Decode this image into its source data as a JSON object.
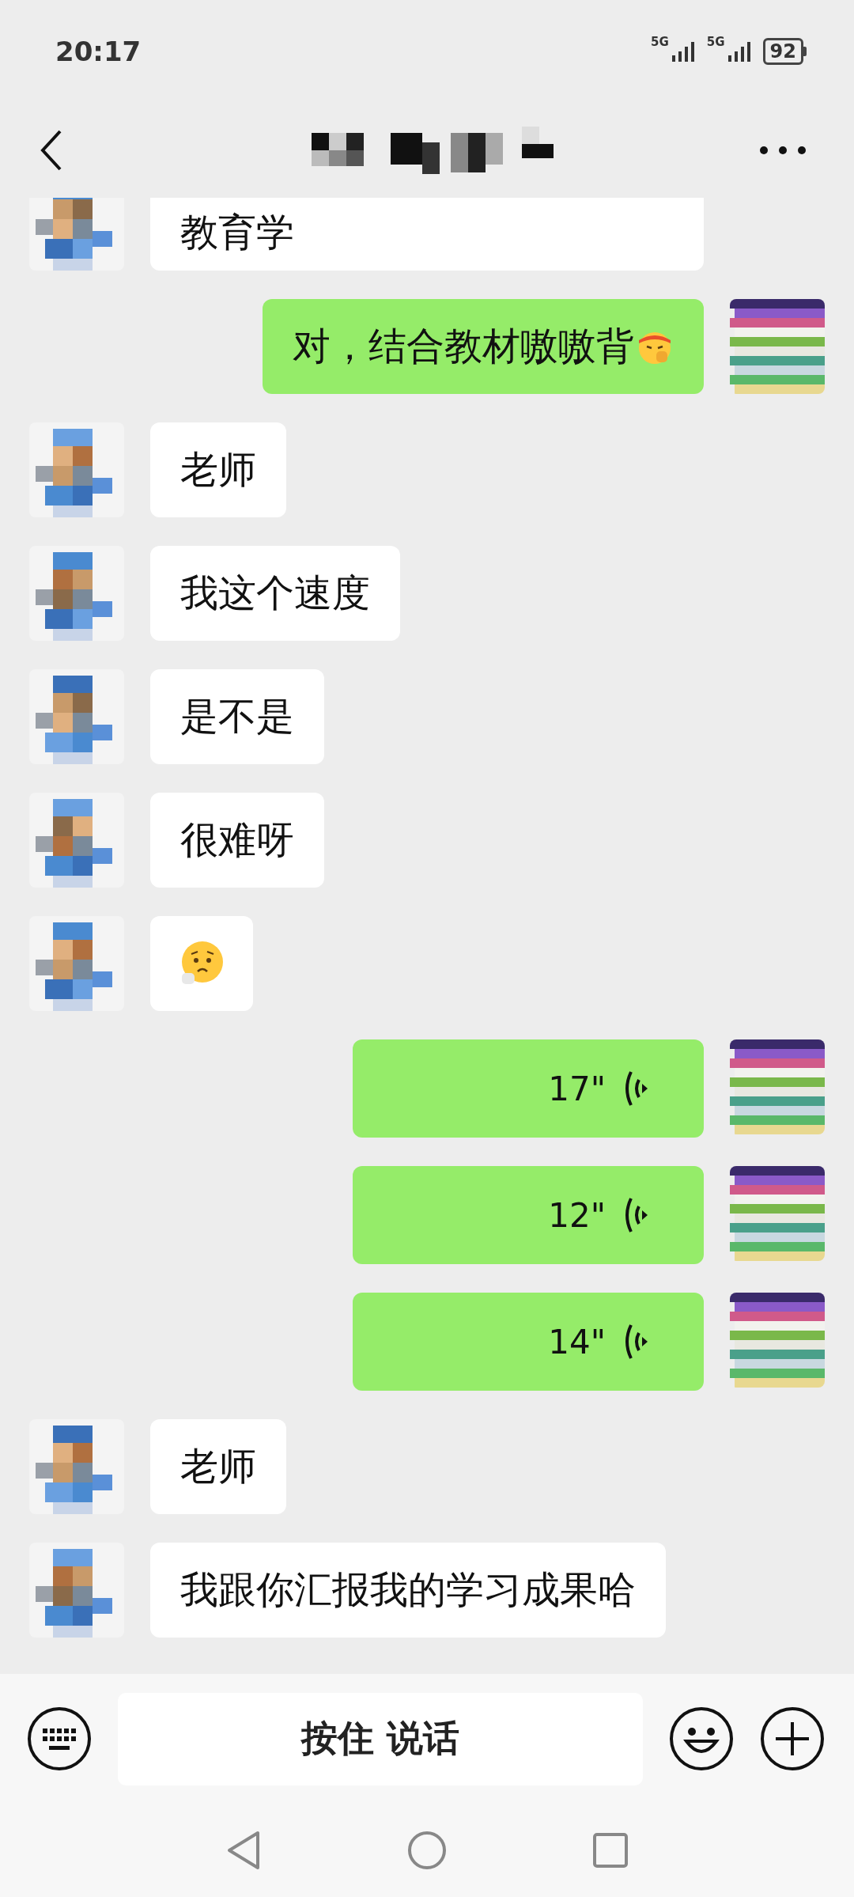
{
  "status_bar": {
    "time": "20:17",
    "networks": [
      {
        "label": "5G"
      },
      {
        "label": "5G"
      }
    ],
    "battery": "92"
  },
  "messages": [
    {
      "outgoing": false,
      "kind": "text",
      "text": "教育学",
      "has_emoji": false,
      "partially_hidden": true
    },
    {
      "outgoing": true,
      "kind": "text",
      "text": "对，结合教材嗷嗷背",
      "has_emoji": true,
      "partially_hidden": false
    },
    {
      "outgoing": false,
      "kind": "text",
      "text": "老师",
      "has_emoji": false,
      "partially_hidden": false
    },
    {
      "outgoing": false,
      "kind": "text",
      "text": "我这个速度",
      "has_emoji": false,
      "partially_hidden": false
    },
    {
      "outgoing": false,
      "kind": "text",
      "text": "是不是",
      "has_emoji": false,
      "partially_hidden": false
    },
    {
      "outgoing": false,
      "kind": "text",
      "text": "很难呀",
      "has_emoji": false,
      "partially_hidden": false
    },
    {
      "outgoing": false,
      "kind": "emoji",
      "partially_hidden": false
    },
    {
      "outgoing": true,
      "kind": "voice",
      "duration": "17\"",
      "partially_hidden": false
    },
    {
      "outgoing": true,
      "kind": "voice",
      "duration": "12\"",
      "partially_hidden": false
    },
    {
      "outgoing": true,
      "kind": "voice",
      "duration": "14\"",
      "partially_hidden": false
    },
    {
      "outgoing": false,
      "kind": "text",
      "text": "老师",
      "has_emoji": false,
      "partially_hidden": false
    },
    {
      "outgoing": false,
      "kind": "text",
      "text": "我跟你汇报我的学习成果哈",
      "has_emoji": false,
      "partially_hidden": false
    }
  ],
  "input_bar": {
    "voice_button": "按住 说话"
  }
}
